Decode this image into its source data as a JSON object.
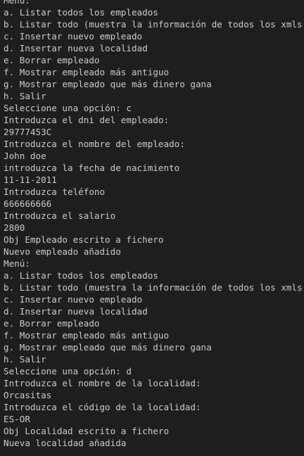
{
  "terminal": {
    "lines": [
      "Menú:",
      "a. Listar todos los empleados",
      "b. Listar todo (muestra la información de todos los xmls)",
      "c. Insertar nuevo empleado",
      "d. Insertar nueva localidad",
      "e. Borrar empleado",
      "f. Mostrar empleado más antiguo",
      "g. Mostrar empleado que más dinero gana",
      "h. Salir",
      "Seleccione una opción: c",
      "Introduzca el dni del empleado:",
      "29777453C",
      "Introduzca el nombre del empleado:",
      "John doe",
      "introduzca la fecha de nacimiento",
      "11-11-2011",
      "Introduzca teléfono",
      "666666666",
      "Introduzca el salario",
      "2800",
      "Obj Empleado escrito a fichero",
      "Nuevo empleado añadido",
      "Menú:",
      "a. Listar todos los empleados",
      "b. Listar todo (muestra la información de todos los xmls)",
      "c. Insertar nuevo empleado",
      "d. Insertar nueva localidad",
      "e. Borrar empleado",
      "f. Mostrar empleado más antiguo",
      "g. Mostrar empleado que más dinero gana",
      "h. Salir",
      "Seleccione una opción: d",
      "Introduzca el nombre de la localidad:",
      "Orcasitas",
      "Introduzca el código de la localidad:",
      "ES-OR",
      "Obj Localidad escrito a fichero",
      "Nueva localidad añadida"
    ]
  },
  "colors": {
    "background": "#1e1e1e",
    "text": "#cccccc"
  }
}
